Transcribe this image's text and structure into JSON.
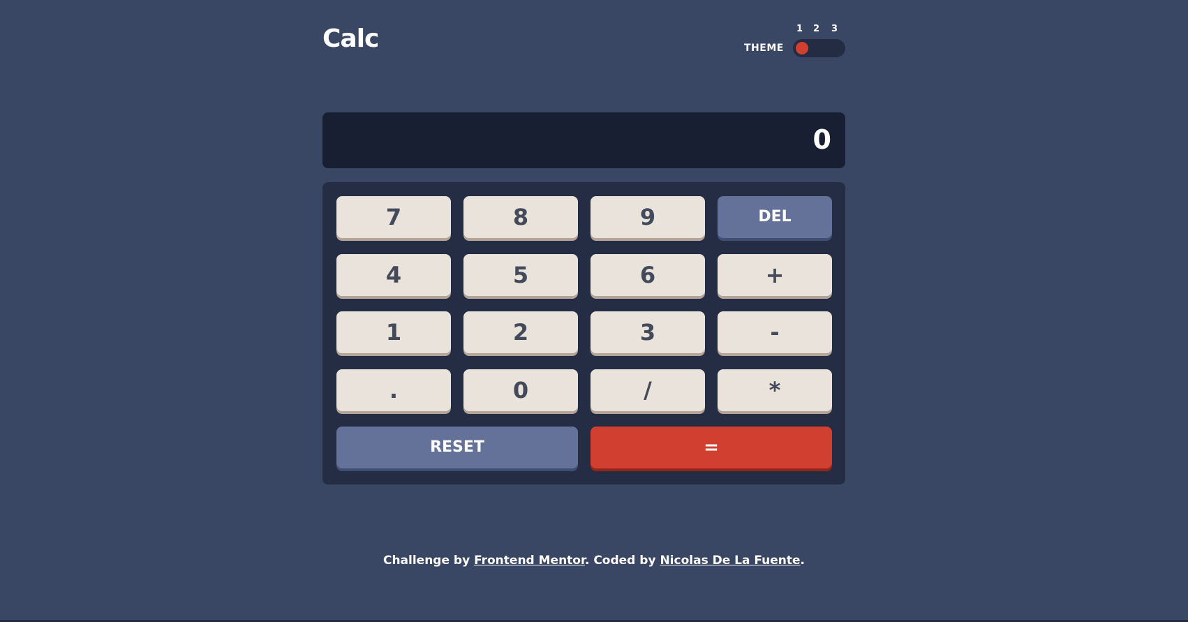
{
  "header": {
    "logo": "Calc",
    "theme_label": "THEME",
    "theme_options": [
      "1",
      "2",
      "3"
    ],
    "selected_theme": 1
  },
  "display": {
    "value": "0"
  },
  "keypad": {
    "keys": [
      "7",
      "8",
      "9",
      "DEL",
      "4",
      "5",
      "6",
      "+",
      "1",
      "2",
      "3",
      "-",
      ".",
      "0",
      "/",
      "*"
    ],
    "reset_label": "RESET",
    "equals_label": "="
  },
  "footer": {
    "prefix": "Challenge by ",
    "link1": "Frontend Mentor",
    "middle": ". Coded by ",
    "link2": "Nicolas De La Fuente",
    "suffix": "."
  },
  "colors": {
    "background": "#3a4764",
    "keypad_background": "#242d44",
    "screen_background": "#181f33",
    "key": "#eae3dc",
    "key_shadow": "#b3a497",
    "key_text": "#434a59",
    "function_key": "#647198",
    "equals_key": "#d03f2f",
    "toggle_knob": "#d03f2f"
  }
}
